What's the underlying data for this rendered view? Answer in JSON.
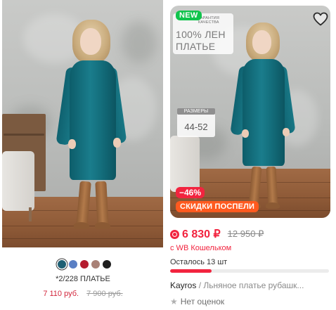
{
  "left_card": {
    "swatches": [
      "#1e5f73",
      "#5a7fc4",
      "#b51c2f",
      "#a98176",
      "#1f1f1f"
    ],
    "selected_swatch": 0,
    "title": "*2/228 ПЛАТЬЕ",
    "price": "7 110 руб.",
    "old_price": "7 900 руб."
  },
  "right_card": {
    "badge_new": "NEW",
    "quality_kicker": "ГАРАНТИЯ КАЧЕСТВА",
    "quality_line1": "100% ЛЕН",
    "quality_line2": "ПЛАТЬЕ",
    "sizes_label": "РАЗМЕРЫ",
    "sizes_value": "44-52",
    "discount": "−46%",
    "promo": "СКИДКИ ПОСПЕЛИ",
    "price": "6 830 ₽",
    "old_price": "12 950 ₽",
    "wallet_note": "с WB Кошельком",
    "stock_text": "Осталось 13 шт",
    "stock_fraction": 0.26,
    "brand": "Kayros",
    "separator": " / ",
    "product_name": "Льняное платье рубашк...",
    "rating_text": "Нет оценок",
    "icons": {
      "favorite": "heart-outline-icon",
      "wallet": "wb-wallet-icon",
      "rating": "star-icon"
    }
  },
  "colors": {
    "accent": "#f2243f",
    "new_badge": "#10c44c",
    "promo": "#ff5a1f"
  }
}
